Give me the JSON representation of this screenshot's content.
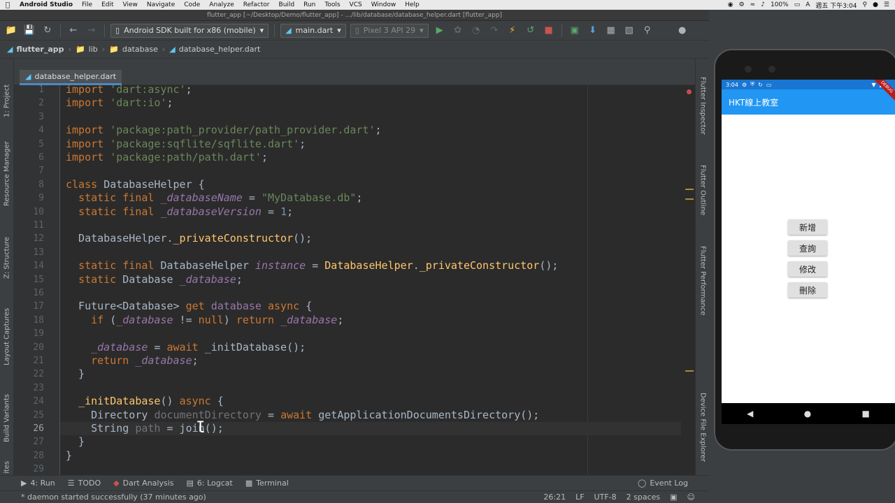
{
  "menubar": {
    "app_name": "Android Studio",
    "items": [
      "File",
      "Edit",
      "View",
      "Navigate",
      "Code",
      "Analyze",
      "Refactor",
      "Build",
      "Run",
      "Tools",
      "VCS",
      "Window",
      "Help"
    ],
    "battery": "100%",
    "input_method": "A",
    "clock": "週五 下午3:04"
  },
  "window": {
    "title": "flutter_app [~/Desktop/Demo/flutter_app] - .../lib/database/database_helper.dart [flutter_app]"
  },
  "toolbar": {
    "device_combo": "Android SDK built for x86 (mobile)",
    "config_combo": "main.dart",
    "emulator_combo": "Pixel 3 API 29"
  },
  "breadcrumb": [
    "flutter_app",
    "lib",
    "database",
    "database_helper.dart"
  ],
  "editor": {
    "tab_label": "database_helper.dart",
    "current_line": 26
  },
  "left_tools": [
    "1: Project",
    "Resource Manager",
    "Z: Structure",
    "Layout Captures",
    "Build Variants",
    "ites"
  ],
  "right_tools": [
    "Flutter Inspector",
    "Flutter Outline",
    "Flutter Performance",
    "Device File Explorer"
  ],
  "bottom_tools": {
    "run": "4: Run",
    "todo": "TODO",
    "dart_analysis": "Dart Analysis",
    "logcat": "6: Logcat",
    "terminal": "Terminal",
    "event_log": "Event Log"
  },
  "status": {
    "message": "* daemon started successfully (37 minutes ago)",
    "position": "26:21",
    "line_sep": "LF",
    "encoding": "UTF-8",
    "indent": "2 spaces"
  },
  "phone": {
    "time": "3:04",
    "app_title": "HKT線上教室",
    "debug_label": "DEBUG",
    "buttons": [
      "新增",
      "查詢",
      "修改",
      "刪除"
    ]
  },
  "colors": {
    "keyword": "#cc7832",
    "string": "#6a8759",
    "field": "#9876aa",
    "number": "#6897bb",
    "function": "#ffc66d",
    "app_bar": "#2196f3"
  }
}
